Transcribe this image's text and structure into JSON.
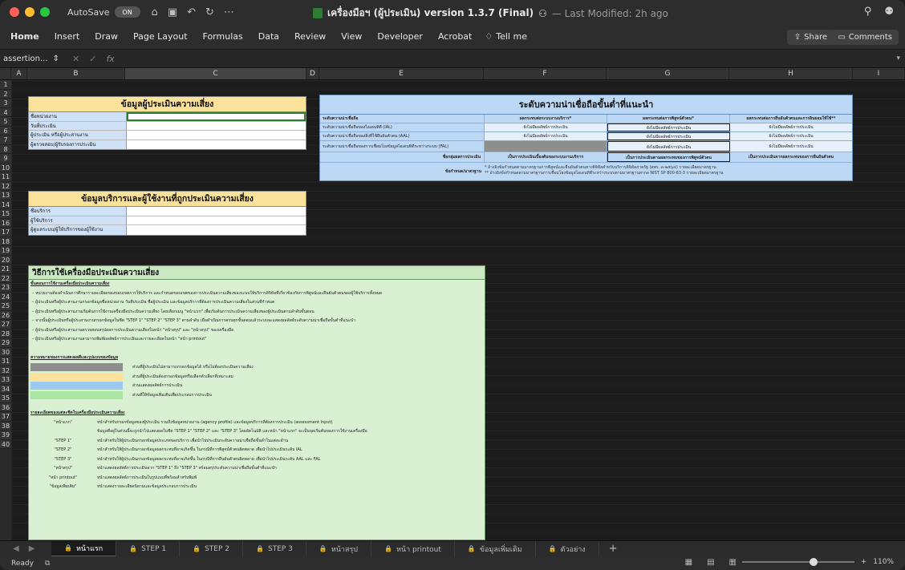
{
  "window": {
    "autosave_label": "AutoSave",
    "autosave_state": "ON",
    "title": "เครื่องมือฯ (ผู้ประเมิน) version 1.3.7 (Final)",
    "modified": "— Last Modified: 2h ago"
  },
  "ribbon": {
    "tabs": [
      "Home",
      "Insert",
      "Draw",
      "Page Layout",
      "Formulas",
      "Data",
      "Review",
      "View",
      "Developer",
      "Acrobat"
    ],
    "tell_me": "Tell me",
    "share": "Share",
    "comments": "Comments"
  },
  "formula_bar": {
    "name_box": "assertion...",
    "fx": "fx"
  },
  "columns": [
    "A",
    "B",
    "C",
    "D",
    "E",
    "F",
    "G",
    "H",
    "I"
  ],
  "rows": [
    "1",
    "2",
    "3",
    "4",
    "5",
    "6",
    "7",
    "8",
    "9",
    "10",
    "11",
    "12",
    "13",
    "14",
    "15",
    "16",
    "17",
    "18",
    "19",
    "20",
    "21",
    "22",
    "23",
    "24",
    "25",
    "26",
    "27",
    "28",
    "29",
    "30",
    "31",
    "32",
    "33",
    "34",
    "35",
    "36",
    "37",
    "38",
    "39",
    "40"
  ],
  "assessment_info": {
    "title": "ข้อมูลผู้ประเมินความเสี่ยง",
    "fields": [
      "ชื่อหน่วยงาน",
      "วันที่ประเมิน",
      "ผู้ประเมิน หรือผู้ประสานงาน",
      "ผู้ตรวจสอบ/ผู้รับรองการประเมิน"
    ]
  },
  "service_info": {
    "title": "ข้อมูลบริการและผู้ใช้งานที่ถูกประเมินความเสี่ยง",
    "fields": [
      "ชื่อบริการ",
      "ผู้ใช้บริการ",
      "ผู้ดูแลระบบ/ผู้ให้บริการของผู้ใช้งาน"
    ]
  },
  "level_table": {
    "title": "ระดับความน่าเชื่อถือขั้นต่ำที่แนะนำ",
    "headers": [
      "ระดับความน่าเชื่อถือ",
      "ผลกระทบต่อระบบงานบริการ*",
      "ผลกระทบต่อการพิสูจน์ตัวตน*",
      "ผลกระทบต่อการยืนยันตัวตนและการยินยอมให้ใช้**"
    ],
    "rows": [
      [
        "ระดับความน่าเชื่อถือของไอเดนทิตี (IAL)",
        "ยังไม่มีผลลัพธ์การประเมิน",
        "ยังไม่มีผลลัพธ์การประเมิน",
        "ยังไม่มีผลลัพธ์การประเมิน"
      ],
      [
        "ระดับความน่าเชื่อถือของสิ่งที่ใช้ยืนยันตัวตน (AAL)",
        "ยังไม่มีผลลัพธ์การประเมิน",
        "ยังไม่มีผลลัพธ์การประเมิน",
        "ยังไม่มีผลลัพธ์การประเมิน"
      ],
      [
        "ระดับความน่าเชื่อถือของการเชื่อมโยงข้อมูลไอเดนทิตีระหว่างระบบ (FAL)",
        "",
        "ยังไม่มีผลลัพธ์การประเมิน",
        "ยังไม่มีผลลัพธ์การประเมิน"
      ]
    ],
    "summary": [
      "ชื่อกลุ่มผลการประเมิน",
      "เป็นการประเมินเบื้องต้นของระบบงานบริการ",
      "เป็นการประเมินตามผลกระทบของการพิสูจน์ตัวตน",
      "เป็นการประเมินจากผลกระทบของการยืนยันตัวตน"
    ],
    "notes_label": "ข้อกำหนด/มาตรฐาน",
    "notes": [
      "* อ้างอิงข้อกำหนดตามมาตรฐานการพิสูจน์และยืนยันตัวตนทางดิจิทัลสำหรับบริการดิจิทัลภาครัฐ (สพร. ๓-๒๕๖๔) รายละเอียดมาตรฐาน",
      "** อ้างอิงข้อกำหนดตามมาตรฐานการเชื่อมโยงข้อมูลไอเดนทิตีระหว่างระบบตามมาตรฐานสากล NIST SP 800-63-3 รายละเอียดมาตรฐาน"
    ]
  },
  "instructions": {
    "title": "วิธีการใช้เครื่องมือประเมินความเสี่ยง",
    "section1": "ขั้นตอนการใช้งานเครื่องมือประเมินความเสี่ยง",
    "lines": [
      "– หน่วยงานต้องดำเนินการศึกษารายละเอียดของขอบเขตการให้บริการ และกำหนดขอบเขตของการประเมินความเสี่ยงของระบบให้บริการดิจิทัลที่เกี่ยวข้องกับการพิสูจน์และยืนยันตัวตนของผู้ใช้บริการทั้งหมด",
      "– ผู้ประเมินหรือผู้ประสานงานกรอกข้อมูลชื่อหน่วยงาน วันที่ประเมิน ชื่อผู้ประเมิน และข้อมูลบริการที่ต้องการประเมินความเสี่ยงในส่วนที่กำหนด",
      "– ผู้ประเมินหรือผู้ประสานงานเริ่มต้นการใช้งานเครื่องมือประเมินความเสี่ยง โดยเลือกเมนู \"หน้าแรก\" เพื่อเริ่มต้นการประเมินความเสี่ยงของผู้ประเมินตามลำดับขั้นตอน",
      "– จากนั้นผู้ประเมินหรือผู้ประสานงานกรอกข้อมูลในชีต \"STEP 1\" \"STEP 2\" \"STEP 3\" ตามลำดับ เมื่อดำเนินการครบทุกขั้นตอนแล้วระบบจะแสดงผลลัพธ์ระดับความน่าเชื่อถือขั้นต่ำที่แนะนำ",
      "– ผู้ประเมินหรือผู้ประสานงานตรวจสอบสรุปผลการประเมินความเสี่ยงในหน้า \"หน้าสรุป\" และ \"หน้าสรุป\" ของเครื่องมือ",
      "– ผู้ประเมินหรือผู้ประสานงานสามารถพิมพ์ผลลัพธ์การประเมินและรายละเอียดในหน้า \"หน้า printout\""
    ],
    "section2": "ความหมายของการแสดงผลสีและรูปแบบของข้อมูล",
    "legend": [
      {
        "color": "#8e8e8e",
        "text": "ส่วนที่ผู้ประเมินไม่สามารถกรอกข้อมูลได้ หรือไม่ต้องประเมินความเสี่ยง"
      },
      {
        "color": "#fbe29a",
        "text": "ส่วนที่ผู้ประเมินต้องกรอกข้อมูลหรือเลือกตัวเลือกที่เหมาะสม"
      },
      {
        "color": "#9ec9f0",
        "text": "ส่วนแสดงผลลัพธ์การประเมิน"
      },
      {
        "color": "#a8e6a1",
        "text": "ส่วนที่ให้ข้อมูลเพิ่มเติมเพื่อประกอบการประเมิน"
      }
    ],
    "section3": "รายละเอียดของแต่ละชีตในเครื่องมือประเมินความเสี่ยง",
    "sheets_desc": [
      {
        "k": "\"หน้าแรก\"",
        "d": "หน้าสำหรับกรอกข้อมูลของผู้ประเมิน รวมถึงข้อมูลหน่วยงาน (agency profile) และข้อมูลบริการที่ต้องการประเมิน (assessment input)"
      },
      {
        "k": "",
        "d": "ข้อมูลที่อยู่ในส่วนนี้จะถูกนำไปแสดงผลในชีต \"STEP 1\" \"STEP 2\" และ \"STEP 3\" โดยอัตโนมัติ และหน้า \"หน้าแรก\" จะเป็นจุดเริ่มต้นของการใช้งานเครื่องมือ"
      },
      {
        "k": "\"STEP 1\"",
        "d": "หน้าสำหรับให้ผู้ประเมินกรอกข้อมูลประเภทของบริการ เพื่อนำไปประเมินระดับความน่าเชื่อถือขั้นต่ำในแต่ละด้าน"
      },
      {
        "k": "\"STEP 2\"",
        "d": "หน้าสำหรับให้ผู้ประเมินกรอกข้อมูลผลกระทบที่อาจเกิดขึ้น ในกรณีที่การพิสูจน์ตัวตนผิดพลาด เพื่อนำไปประเมินระดับ IAL"
      },
      {
        "k": "\"STEP 3\"",
        "d": "หน้าสำหรับให้ผู้ประเมินกรอกข้อมูลผลกระทบที่อาจเกิดขึ้น ในกรณีที่การยืนยันตัวตนผิดพลาด เพื่อนำไปประเมินระดับ AAL และ FAL"
      },
      {
        "k": "\"หน้าสรุป\"",
        "d": "หน้าแสดงผลลัพธ์การประเมินจาก \"STEP 1\" ถึง \"STEP 3\" พร้อมสรุประดับความน่าเชื่อถือขั้นต่ำที่แนะนำ"
      },
      {
        "k": "\"หน้า printout\"",
        "d": "หน้าแสดงผลลัพธ์การประเมินในรูปแบบที่พร้อมสำหรับพิมพ์"
      },
      {
        "k": "\"ข้อมูลเพิ่มเติม\"",
        "d": "หน้าแสดงรายละเอียดนิยามและข้อมูลประกอบการประเมิน"
      }
    ]
  },
  "sheet_tabs": [
    "หน้าแรก",
    "STEP 1",
    "STEP 2",
    "STEP 3",
    "หน้าสรุป",
    "หน้า printout",
    "ข้อมูลเพิ่มเติม",
    "ตัวอย่าง"
  ],
  "status": {
    "ready": "Ready",
    "zoom": "110%"
  }
}
